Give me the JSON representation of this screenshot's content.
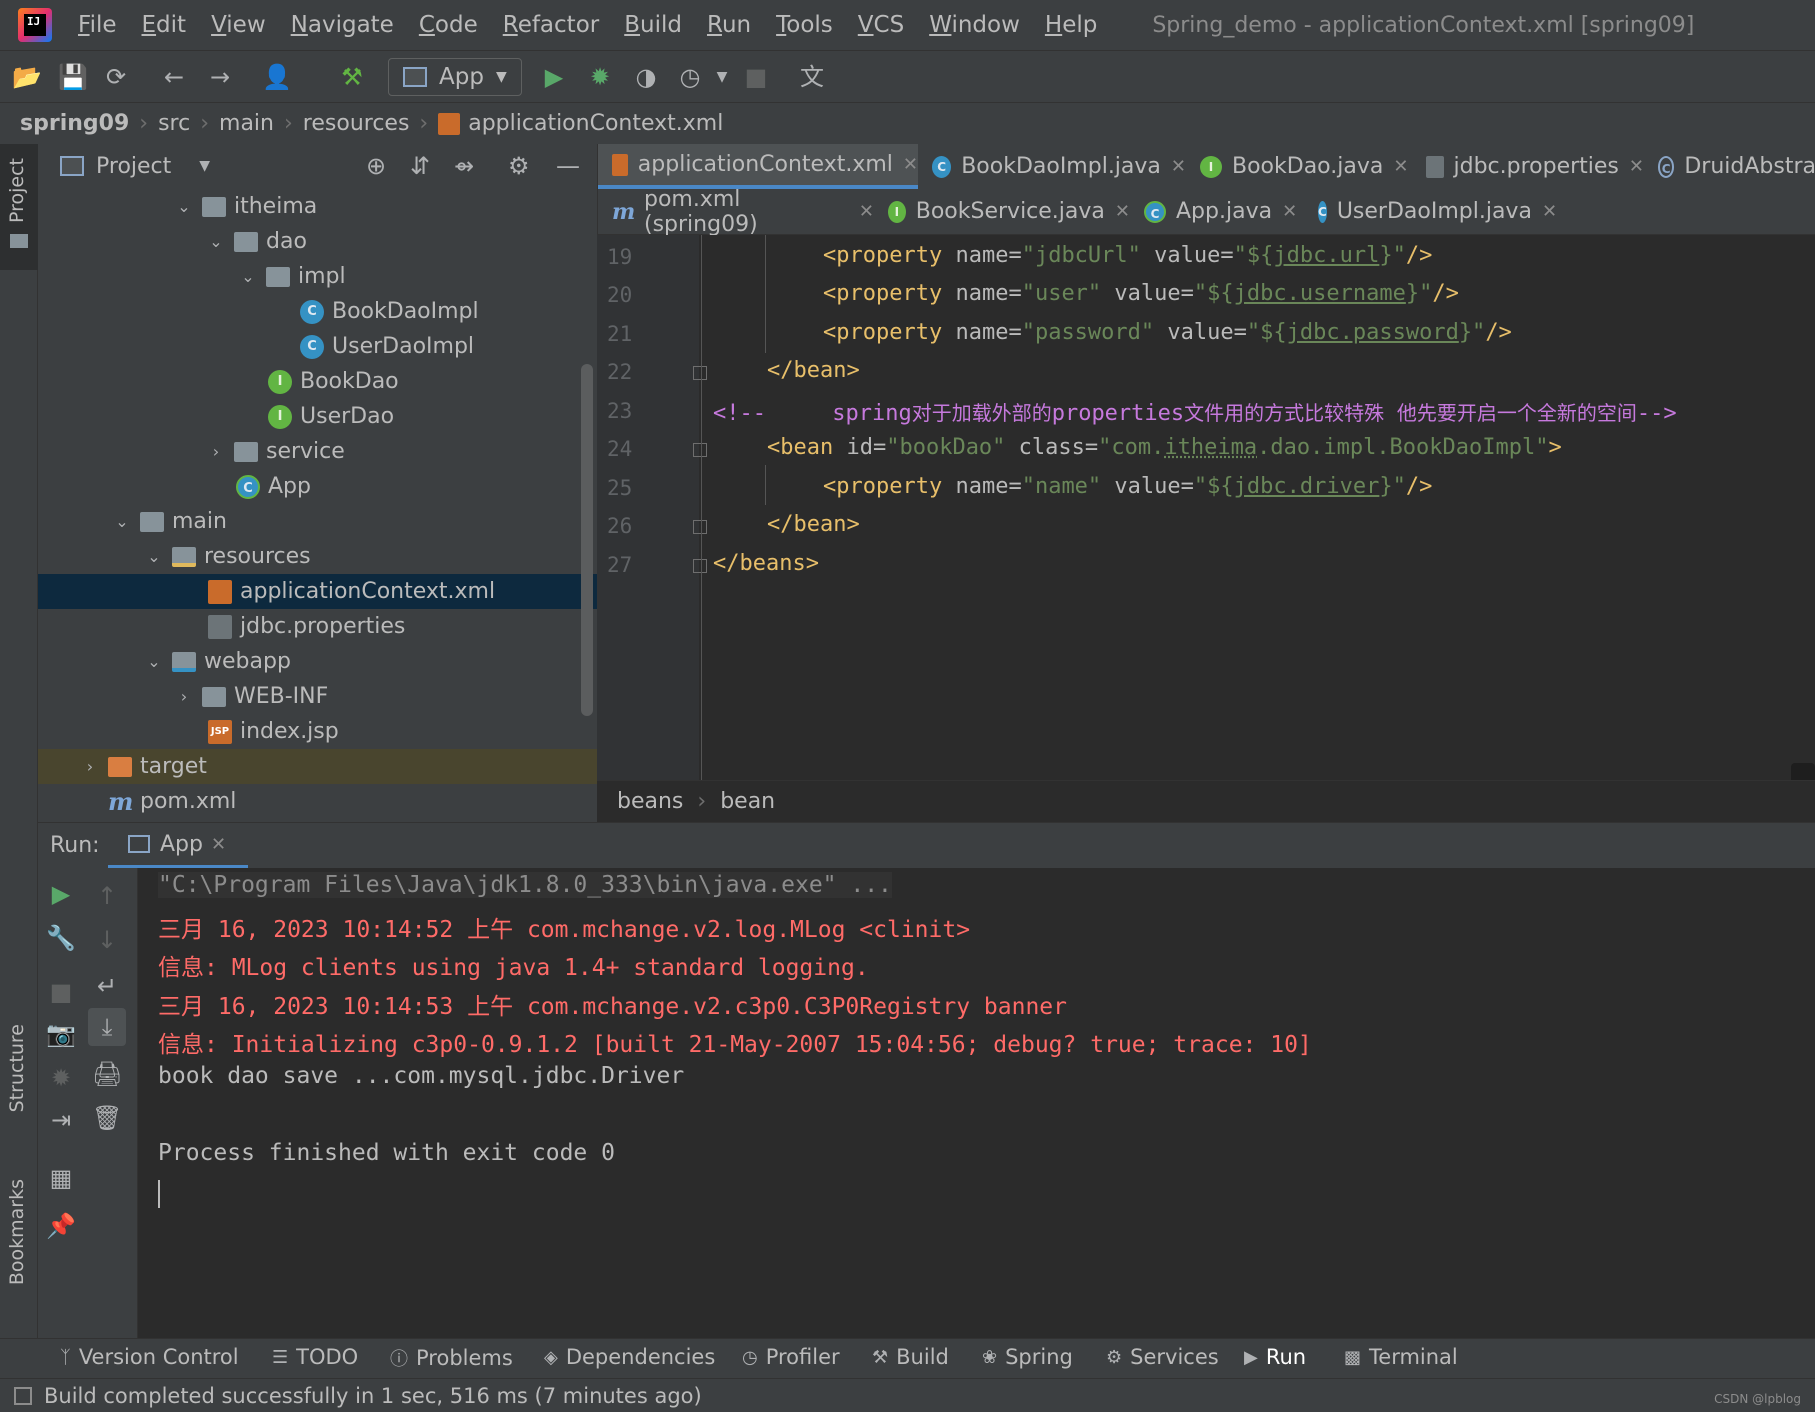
{
  "menubar": {
    "logo_text": "IJ",
    "items": [
      "File",
      "Edit",
      "View",
      "Navigate",
      "Code",
      "Refactor",
      "Build",
      "Run",
      "Tools",
      "VCS",
      "Window",
      "Help"
    ],
    "window_title": "Spring_demo - applicationContext.xml [spring09]"
  },
  "toolbar": {
    "run_config": "App"
  },
  "breadcrumb": [
    "spring09",
    "src",
    "main",
    "resources",
    "applicationContext.xml"
  ],
  "left_strip": {
    "project": "Project",
    "structure": "Structure",
    "bookmarks": "Bookmarks"
  },
  "project": {
    "title": "Project",
    "tree": [
      {
        "label": "itheima",
        "kind": "folder",
        "arrow": "v"
      },
      {
        "label": "dao",
        "kind": "folder",
        "arrow": "v"
      },
      {
        "label": "impl",
        "kind": "folder",
        "arrow": "v"
      },
      {
        "label": "BookDaoImpl",
        "kind": "class",
        "badge": "C"
      },
      {
        "label": "UserDaoImpl",
        "kind": "class",
        "badge": "C"
      },
      {
        "label": "BookDao",
        "kind": "iface",
        "badge": "I"
      },
      {
        "label": "UserDao",
        "kind": "iface",
        "badge": "I"
      },
      {
        "label": "service",
        "kind": "folder",
        "arrow": ">"
      },
      {
        "label": "App",
        "kind": "app",
        "badge": "C"
      },
      {
        "label": "main",
        "kind": "folder",
        "arrow": "v"
      },
      {
        "label": "resources",
        "kind": "folder",
        "arrow": "v"
      },
      {
        "label": "applicationContext.xml",
        "kind": "xml",
        "badge": ""
      },
      {
        "label": "jdbc.properties",
        "kind": "props",
        "badge": ""
      },
      {
        "label": "webapp",
        "kind": "folder-blue",
        "arrow": "v"
      },
      {
        "label": "WEB-INF",
        "kind": "folder",
        "arrow": ">"
      },
      {
        "label": "index.jsp",
        "kind": "jsp",
        "badge": "JSP"
      },
      {
        "label": "target",
        "kind": "folder-orange",
        "arrow": ">"
      },
      {
        "label": "pom.xml",
        "kind": "maven",
        "badge": "m"
      }
    ]
  },
  "editor": {
    "tabs_row1": [
      {
        "label": "applicationContext.xml",
        "active": true
      },
      {
        "label": "BookDaoImpl.java",
        "active": false
      },
      {
        "label": "BookDao.java",
        "active": false
      },
      {
        "label": "jdbc.properties",
        "active": false
      },
      {
        "label": "DruidAbstra",
        "active": false
      }
    ],
    "tabs_row2": [
      {
        "label": "pom.xml (spring09)"
      },
      {
        "label": "BookService.java"
      },
      {
        "label": "App.java"
      },
      {
        "label": "UserDaoImpl.java"
      }
    ],
    "line_numbers": [
      "19",
      "20",
      "21",
      "22",
      "23",
      "24",
      "25",
      "26",
      "27"
    ],
    "code": {
      "l19": {
        "open": "<",
        "tag": "property",
        "a1": " name=",
        "v1": "\"jdbcUrl\"",
        "a2": " value=",
        "q1": "\"${",
        "ref": "jdbc.url",
        "q2": "}\"",
        "close": "/>"
      },
      "l20": {
        "open": "<",
        "tag": "property",
        "a1": " name=",
        "v1": "\"user\"",
        "a2": " value=",
        "q1": "\"${",
        "ref": "jdbc.username",
        "q2": "}\"",
        "close": "/>"
      },
      "l21": {
        "open": "<",
        "tag": "property",
        "a1": " name=",
        "v1": "\"password\"",
        "a2": " value=",
        "q1": "\"${",
        "ref": "jdbc.password",
        "q2": "}\"",
        "close": "/>"
      },
      "l22": "</bean>",
      "l23": {
        "start": "<!--",
        "spring": "spring",
        "text1": "对于加载外部的",
        "props": "properties",
        "text2": "文件用的方式比较特殊  他先要开启一个全新的空间",
        "end": "-->"
      },
      "l24": {
        "open": "<",
        "tag": "bean",
        "a1": " id=",
        "v1": "\"bookDao\"",
        "a2": " class=",
        "v2a": "\"com.",
        "v2ref": "itheima",
        "v2b": ".dao.impl.BookDaoImpl\"",
        "close": ">"
      },
      "l25": {
        "open": "<",
        "tag": "property",
        "a1": " name=",
        "v1": "\"name\"",
        "a2": " value=",
        "q1": "\"${",
        "ref": "jdbc.driver",
        "q2": "}\"",
        "close": "/>"
      },
      "l26": "</bean>",
      "l27": "</beans>"
    },
    "crumb": [
      "beans",
      "bean"
    ]
  },
  "run": {
    "label": "Run:",
    "tab": "App",
    "console": [
      {
        "text": "\"C:\\Program Files\\Java\\jdk1.8.0_333\\bin\\java.exe\" ...",
        "style": "gray"
      },
      {
        "text": "三月 16, 2023 10:14:52 上午 com.mchange.v2.log.MLog <clinit>",
        "style": "red"
      },
      {
        "text": "信息: MLog clients using java 1.4+ standard logging.",
        "style": "red"
      },
      {
        "text": "三月 16, 2023 10:14:53 上午 com.mchange.v2.c3p0.C3P0Registry banner",
        "style": "red"
      },
      {
        "text": "信息: Initializing c3p0-0.9.1.2 [built 21-May-2007 15:04:56; debug? true; trace: 10]",
        "style": "red"
      },
      {
        "text": "book dao save ...com.mysql.jdbc.Driver",
        "style": "norm"
      },
      {
        "text": "",
        "style": "norm"
      },
      {
        "text": "Process finished with exit code 0",
        "style": "norm"
      }
    ]
  },
  "bottom_tools": [
    {
      "label": "Version Control",
      "icon": "branch-icon"
    },
    {
      "label": "TODO",
      "icon": "list-icon"
    },
    {
      "label": "Problems",
      "icon": "problems-icon"
    },
    {
      "label": "Dependencies",
      "icon": "dependencies-icon"
    },
    {
      "label": "Profiler",
      "icon": "profiler-icon"
    },
    {
      "label": "Build",
      "icon": "hammer-icon"
    },
    {
      "label": "Spring",
      "icon": "spring-icon"
    },
    {
      "label": "Services",
      "icon": "services-icon"
    },
    {
      "label": "Run",
      "icon": "play-icon"
    },
    {
      "label": "Terminal",
      "icon": "terminal-icon"
    }
  ],
  "status": {
    "text": "Build completed successfully in 1 sec, 516 ms (7 minutes ago)"
  },
  "watermark": "CSDN @lpblog",
  "colors": {
    "background": "#2b2b2b",
    "panel": "#3c3f41",
    "selection": "#0d293e",
    "accent": "#4a88c7",
    "error_text": "#ff6b68",
    "xml_tag": "#e8bf6a",
    "xml_value": "#6a8759",
    "comment": "#c679dd"
  }
}
